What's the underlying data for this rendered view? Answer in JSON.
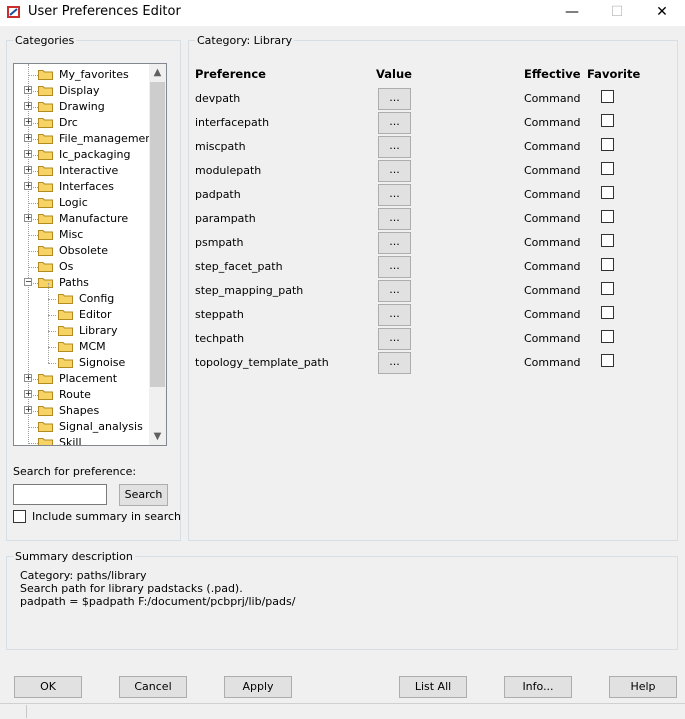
{
  "window": {
    "title": "User Preferences Editor",
    "min": "—",
    "max": "☐",
    "close": "✕"
  },
  "categories": {
    "group_label": "Categories",
    "tree": [
      {
        "label": "My_favorites",
        "level": 0,
        "expander": ""
      },
      {
        "label": "Display",
        "level": 0,
        "expander": "+"
      },
      {
        "label": "Drawing",
        "level": 0,
        "expander": "+"
      },
      {
        "label": "Drc",
        "level": 0,
        "expander": "+"
      },
      {
        "label": "File_management",
        "level": 0,
        "expander": "+"
      },
      {
        "label": "Ic_packaging",
        "level": 0,
        "expander": "+"
      },
      {
        "label": "Interactive",
        "level": 0,
        "expander": "+"
      },
      {
        "label": "Interfaces",
        "level": 0,
        "expander": "+"
      },
      {
        "label": "Logic",
        "level": 0,
        "expander": ""
      },
      {
        "label": "Manufacture",
        "level": 0,
        "expander": "+"
      },
      {
        "label": "Misc",
        "level": 0,
        "expander": ""
      },
      {
        "label": "Obsolete",
        "level": 0,
        "expander": ""
      },
      {
        "label": "Os",
        "level": 0,
        "expander": ""
      },
      {
        "label": "Paths",
        "level": 0,
        "expander": "−"
      },
      {
        "label": "Config",
        "level": 1,
        "expander": ""
      },
      {
        "label": "Editor",
        "level": 1,
        "expander": ""
      },
      {
        "label": "Library",
        "level": 1,
        "expander": ""
      },
      {
        "label": "MCM",
        "level": 1,
        "expander": ""
      },
      {
        "label": "Signoise",
        "level": 1,
        "expander": ""
      },
      {
        "label": "Placement",
        "level": 0,
        "expander": "+"
      },
      {
        "label": "Route",
        "level": 0,
        "expander": "+"
      },
      {
        "label": "Shapes",
        "level": 0,
        "expander": "+"
      },
      {
        "label": "Signal_analysis",
        "level": 0,
        "expander": ""
      },
      {
        "label": "Skill",
        "level": 0,
        "expander": ""
      }
    ],
    "search_label": "Search for preference:",
    "search_value": "",
    "search_button": "Search",
    "include_summary_label": "Include summary in search",
    "include_summary_checked": false
  },
  "category_panel": {
    "group_label": "Category:  Library",
    "headers": {
      "preference": "Preference",
      "value": "Value",
      "effective": "Effective",
      "favorite": "Favorite"
    },
    "rows": [
      {
        "name": "devpath",
        "value": "...",
        "effective": "Command",
        "favorite": false
      },
      {
        "name": "interfacepath",
        "value": "...",
        "effective": "Command",
        "favorite": false
      },
      {
        "name": "miscpath",
        "value": "...",
        "effective": "Command",
        "favorite": false
      },
      {
        "name": "modulepath",
        "value": "...",
        "effective": "Command",
        "favorite": false
      },
      {
        "name": "padpath",
        "value": "...",
        "effective": "Command",
        "favorite": false
      },
      {
        "name": "parampath",
        "value": "...",
        "effective": "Command",
        "favorite": false
      },
      {
        "name": "psmpath",
        "value": "...",
        "effective": "Command",
        "favorite": false
      },
      {
        "name": "step_facet_path",
        "value": "...",
        "effective": "Command",
        "favorite": false
      },
      {
        "name": "step_mapping_path",
        "value": "...",
        "effective": "Command",
        "favorite": false
      },
      {
        "name": "steppath",
        "value": "...",
        "effective": "Command",
        "favorite": false
      },
      {
        "name": "techpath",
        "value": "...",
        "effective": "Command",
        "favorite": false
      },
      {
        "name": "topology_template_path",
        "value": "...",
        "effective": "Command",
        "favorite": false
      }
    ]
  },
  "summary": {
    "group_label": "Summary description",
    "lines": [
      "Category: paths/library",
      "Search path for library padstacks (.pad).",
      "padpath = $padpath F:/document/pcbprj/lib/pads/"
    ]
  },
  "buttons": {
    "ok": "OK",
    "cancel": "Cancel",
    "apply": "Apply",
    "list_all": "List All",
    "info": "Info...",
    "help": "Help"
  },
  "colors": {
    "background": "#f0f0f0",
    "folder": "#f6d365",
    "folder_outline": "#b58a1e",
    "group_border": "#d5dfe5"
  }
}
